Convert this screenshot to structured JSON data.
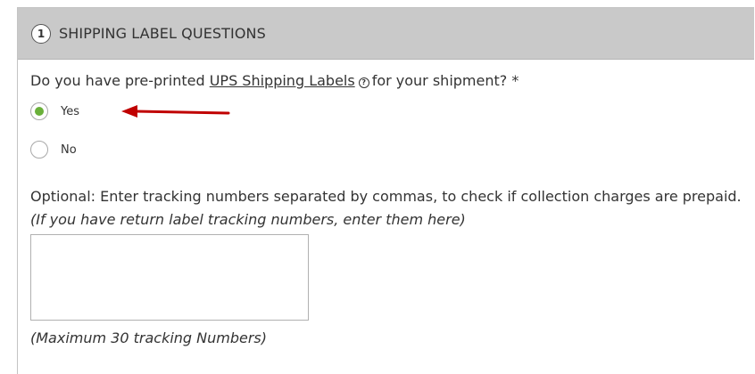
{
  "section": {
    "step_number": "1",
    "title": "SHIPPING LABEL QUESTIONS"
  },
  "question": {
    "prefix": "Do you have pre-printed ",
    "link_text": "UPS Shipping Labels",
    "help_icon": "question-circle-icon",
    "suffix": "for your shipment? *"
  },
  "options": {
    "yes_label": "Yes",
    "yes_selected": true,
    "no_label": "No",
    "no_selected": false
  },
  "annotation": {
    "arrow_color": "#c00000",
    "arrow_icon": "red-arrow-pointing-left"
  },
  "tracking": {
    "optional_text": "Optional: Enter tracking numbers separated by commas, to check if collection charges are prepaid.",
    "hint_text": "(If you have return label tracking numbers, enter them here)",
    "value": "",
    "max_note": "(Maximum 30 tracking Numbers)"
  },
  "colors": {
    "header_bg": "#c9c9c9",
    "radio_selected": "#6ab03a"
  }
}
